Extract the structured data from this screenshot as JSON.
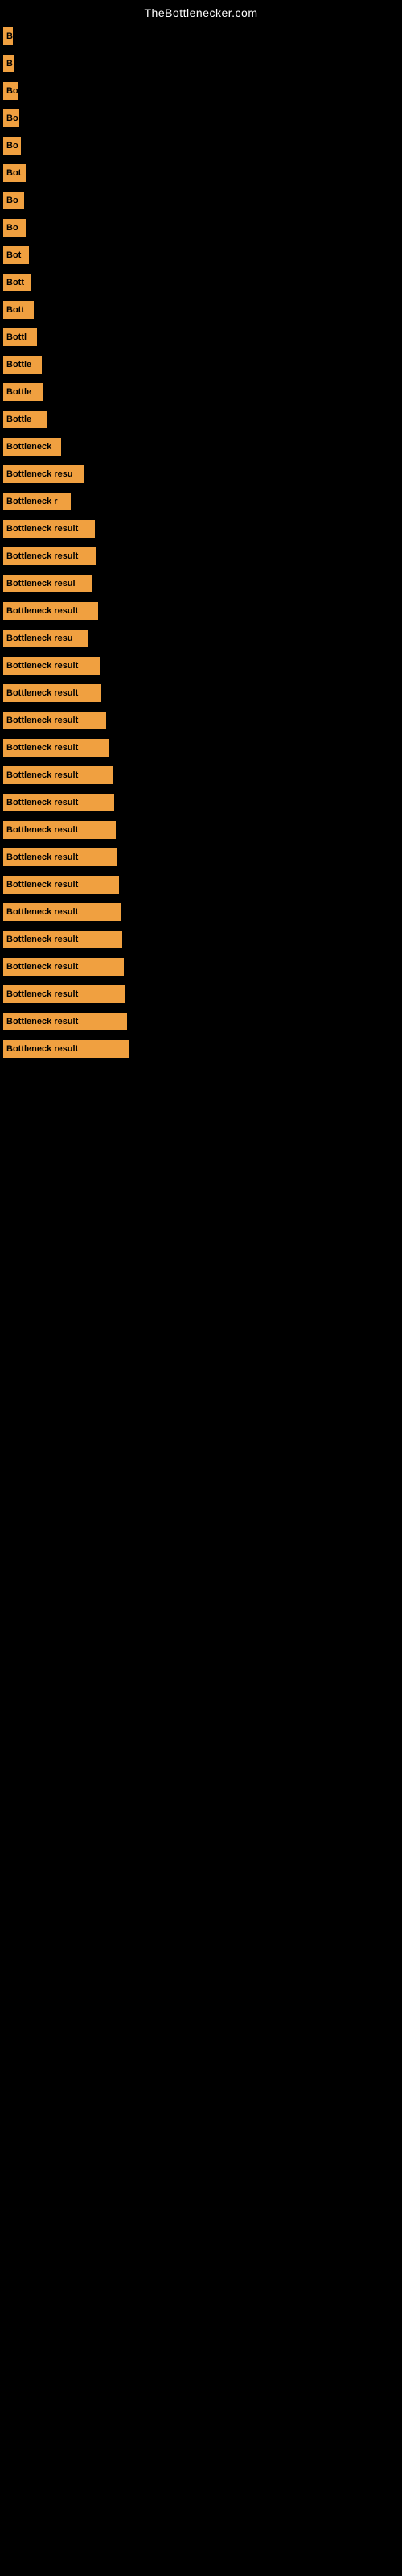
{
  "site_title": "TheBottlenecker.com",
  "bars": [
    {
      "label": "B",
      "width": 12
    },
    {
      "label": "B",
      "width": 14
    },
    {
      "label": "Bo",
      "width": 18
    },
    {
      "label": "Bo",
      "width": 20
    },
    {
      "label": "Bo",
      "width": 22
    },
    {
      "label": "Bot",
      "width": 28
    },
    {
      "label": "Bo",
      "width": 26
    },
    {
      "label": "Bo",
      "width": 28
    },
    {
      "label": "Bot",
      "width": 32
    },
    {
      "label": "Bott",
      "width": 34
    },
    {
      "label": "Bott",
      "width": 38
    },
    {
      "label": "Bottl",
      "width": 42
    },
    {
      "label": "Bottle",
      "width": 48
    },
    {
      "label": "Bottle",
      "width": 50
    },
    {
      "label": "Bottle",
      "width": 54
    },
    {
      "label": "Bottleneck",
      "width": 72
    },
    {
      "label": "Bottleneck resu",
      "width": 100
    },
    {
      "label": "Bottleneck r",
      "width": 84
    },
    {
      "label": "Bottleneck result",
      "width": 114
    },
    {
      "label": "Bottleneck result",
      "width": 116
    },
    {
      "label": "Bottleneck resul",
      "width": 110
    },
    {
      "label": "Bottleneck result",
      "width": 118
    },
    {
      "label": "Bottleneck resu",
      "width": 106
    },
    {
      "label": "Bottleneck result",
      "width": 120
    },
    {
      "label": "Bottleneck result",
      "width": 122
    },
    {
      "label": "Bottleneck result",
      "width": 128
    },
    {
      "label": "Bottleneck result",
      "width": 132
    },
    {
      "label": "Bottleneck result",
      "width": 136
    },
    {
      "label": "Bottleneck result",
      "width": 138
    },
    {
      "label": "Bottleneck result",
      "width": 140
    },
    {
      "label": "Bottleneck result",
      "width": 142
    },
    {
      "label": "Bottleneck result",
      "width": 144
    },
    {
      "label": "Bottleneck result",
      "width": 146
    },
    {
      "label": "Bottleneck result",
      "width": 148
    },
    {
      "label": "Bottleneck result",
      "width": 150
    },
    {
      "label": "Bottleneck result",
      "width": 152
    },
    {
      "label": "Bottleneck result",
      "width": 154
    },
    {
      "label": "Bottleneck result",
      "width": 156
    }
  ]
}
